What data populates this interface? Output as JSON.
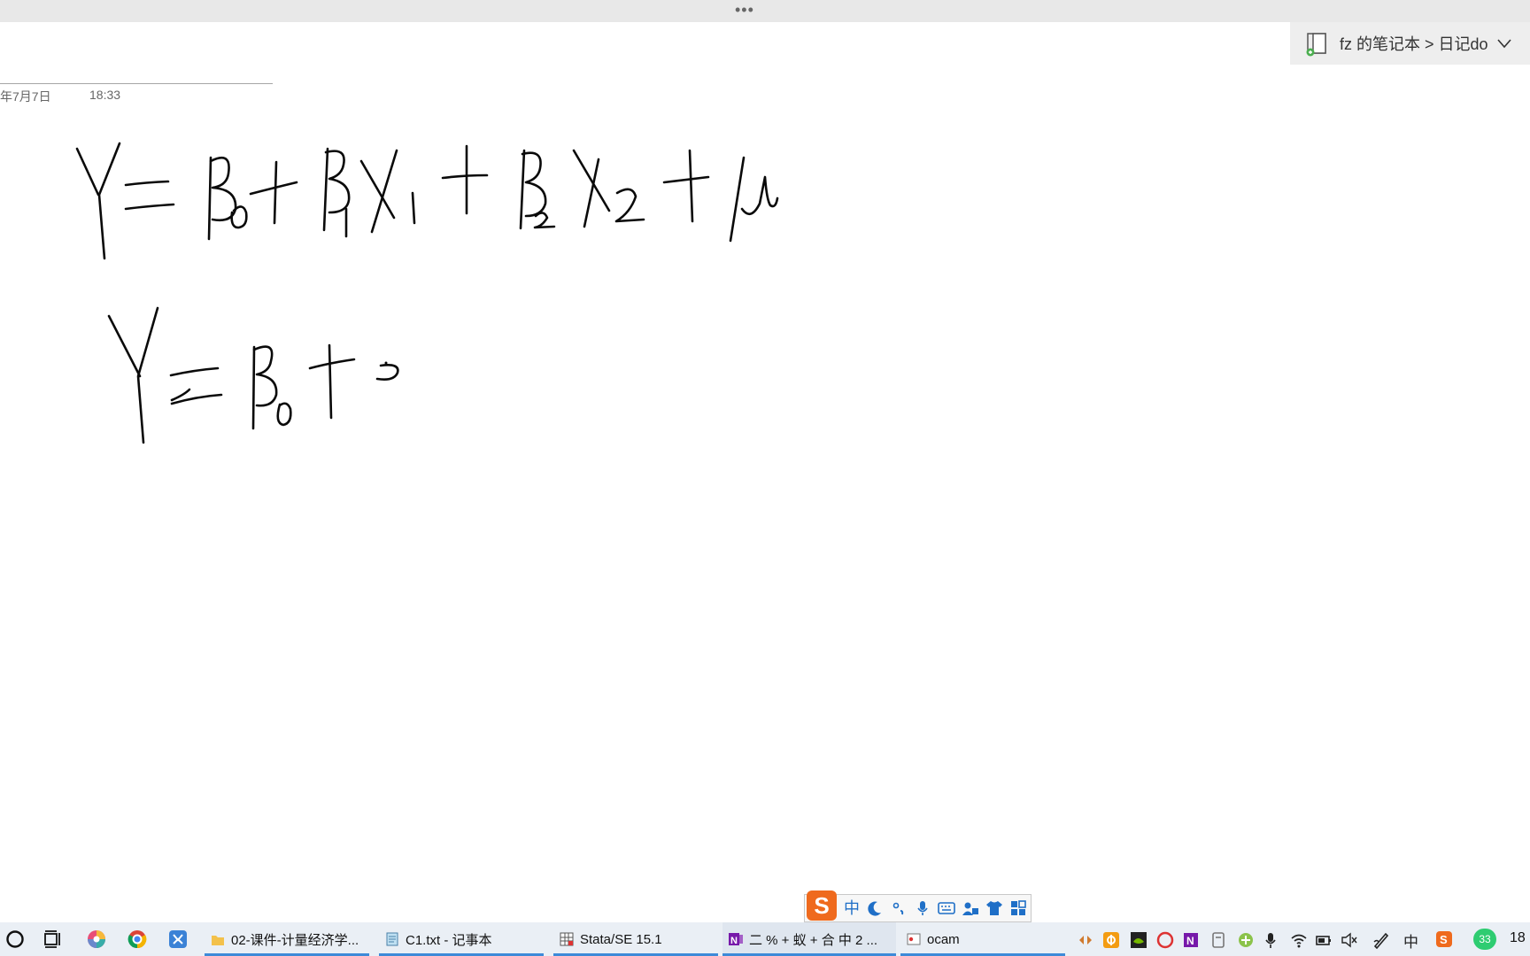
{
  "notebook": {
    "breadcrumb": "fz 的笔记本 > 日记do"
  },
  "page": {
    "date": "年7月7日",
    "time": "18:33"
  },
  "ime": {
    "mode": "中"
  },
  "taskbar": {
    "tasks": [
      {
        "label": "02-课件-计量经济学...",
        "icon": "folder-icon"
      },
      {
        "label": "C1.txt - 记事本",
        "icon": "notepad-icon"
      },
      {
        "label": "Stata/SE 15.1",
        "icon": "stata-icon"
      },
      {
        "label": "二 % + 蚁 + 合 中 2 ...",
        "icon": "onenote-icon"
      },
      {
        "label": "ocam",
        "icon": "ocam-icon"
      }
    ],
    "tray_ime": "中",
    "battery_badge": "33",
    "clock": "18"
  },
  "colors": {
    "accent": "#3d8ad8",
    "ime_orange": "#ef6a1d",
    "ink": "#0a0a0a"
  }
}
